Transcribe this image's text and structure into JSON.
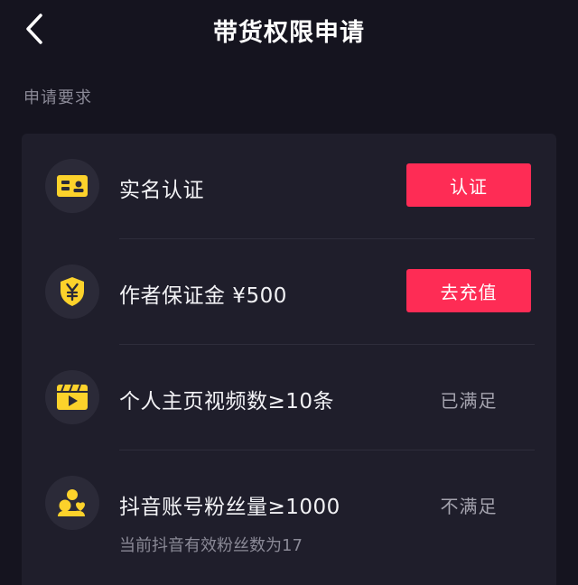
{
  "header": {
    "back_icon": "chevron-left-icon",
    "title": "带货权限申请"
  },
  "section": {
    "label": "申请要求"
  },
  "requirements": [
    {
      "icon": "id-card-icon",
      "label": "实名认证",
      "action_label": "认证"
    },
    {
      "icon": "yen-shield-icon",
      "label": "作者保证金 ¥500",
      "action_label": "去充值"
    },
    {
      "icon": "video-clapper-icon",
      "label": "个人主页视频数≥10条",
      "status": "已满足"
    },
    {
      "icon": "fans-icon",
      "label": "抖音账号粉丝量≥1000",
      "status": "不满足",
      "sub_label": "当前抖音有效粉丝数为17"
    }
  ],
  "colors": {
    "background": "#15141f",
    "card": "#1f1e2b",
    "accent_red": "#fe2c55",
    "icon_yellow": "#fcd22b"
  }
}
